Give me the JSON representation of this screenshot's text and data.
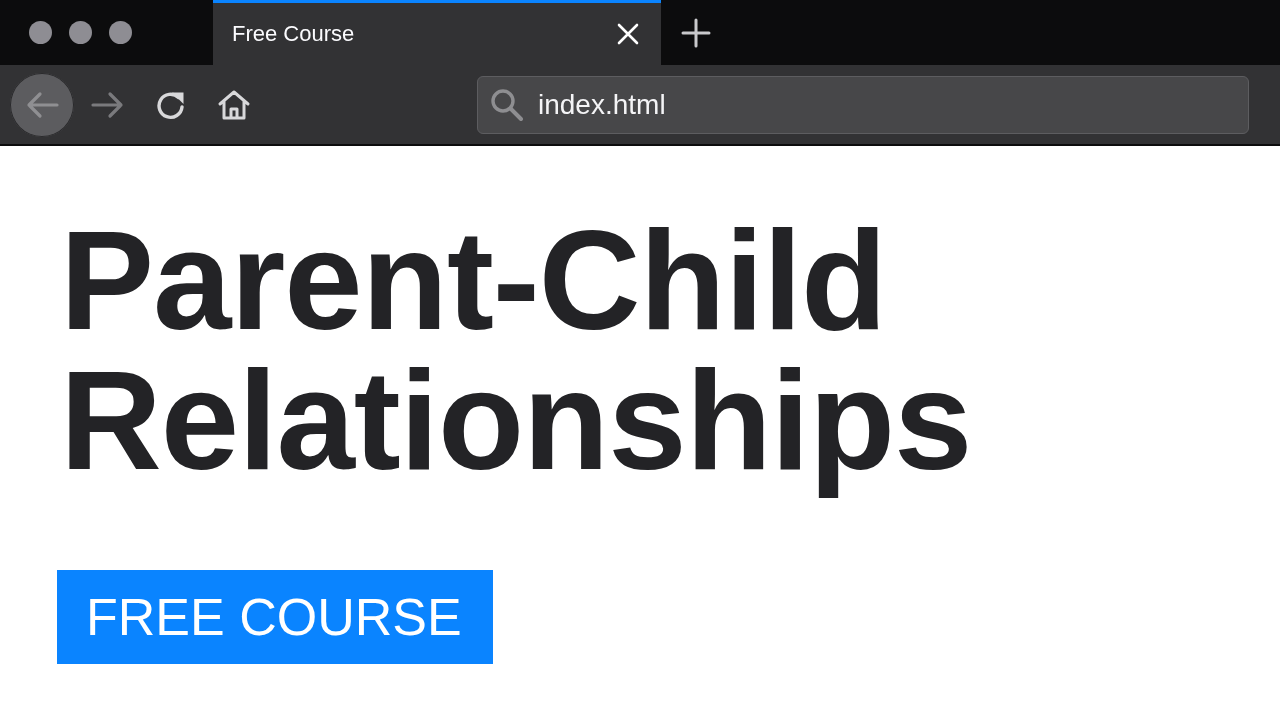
{
  "tabs": [
    {
      "title": "Free Course",
      "selected": true
    }
  ],
  "toolbar": {
    "buttons": [
      {
        "kind": "back",
        "disabled": true,
        "hovered": true
      },
      {
        "kind": "forward",
        "disabled": true,
        "hovered": false
      },
      {
        "kind": "reload",
        "disabled": false,
        "hovered": false
      },
      {
        "kind": "home",
        "disabled": false,
        "hovered": false
      }
    ]
  },
  "address_bar": {
    "value": "index.html"
  },
  "page": {
    "heading": "Parent-Child Relationships",
    "button": "FREE COURSE"
  }
}
